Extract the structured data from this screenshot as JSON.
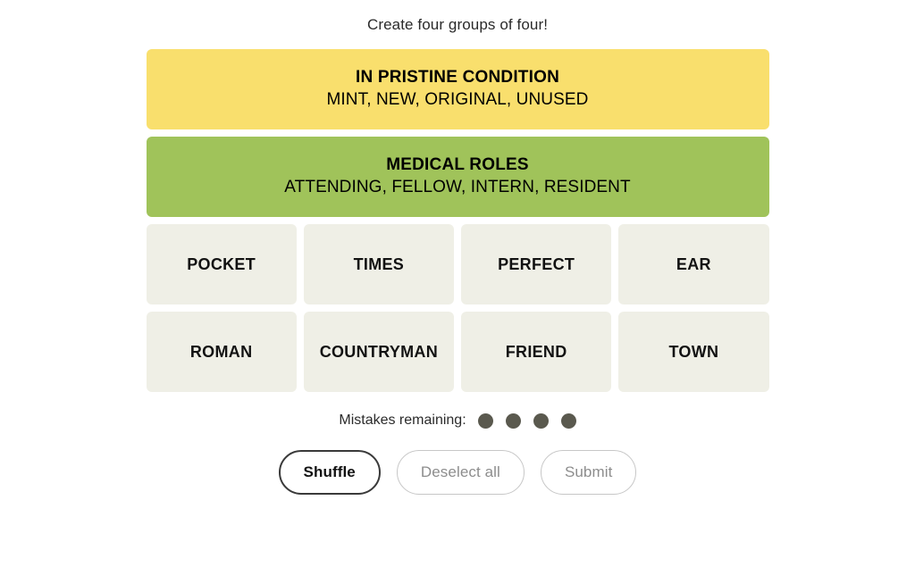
{
  "header": {
    "instruction": "Create four groups of four!"
  },
  "board": {
    "solved_groups": [
      {
        "title": "IN PRISTINE CONDITION",
        "members": "MINT, NEW, ORIGINAL, UNUSED",
        "color": "#f9df6d",
        "difficulty": "yellow"
      },
      {
        "title": "MEDICAL ROLES",
        "members": "ATTENDING, FELLOW, INTERN, RESIDENT",
        "color": "#a0c35a",
        "difficulty": "green"
      }
    ],
    "tile_rows": [
      [
        "POCKET",
        "TIMES",
        "PERFECT",
        "EAR"
      ],
      [
        "ROMAN",
        "COUNTRYMAN",
        "FRIEND",
        "TOWN"
      ]
    ],
    "tile_color": "#efefe6"
  },
  "mistakes": {
    "label": "Mistakes remaining:",
    "remaining": 4,
    "dot_color": "#5a594e"
  },
  "controls": {
    "shuffle_label": "Shuffle",
    "deselect_label": "Deselect all",
    "submit_label": "Submit"
  }
}
